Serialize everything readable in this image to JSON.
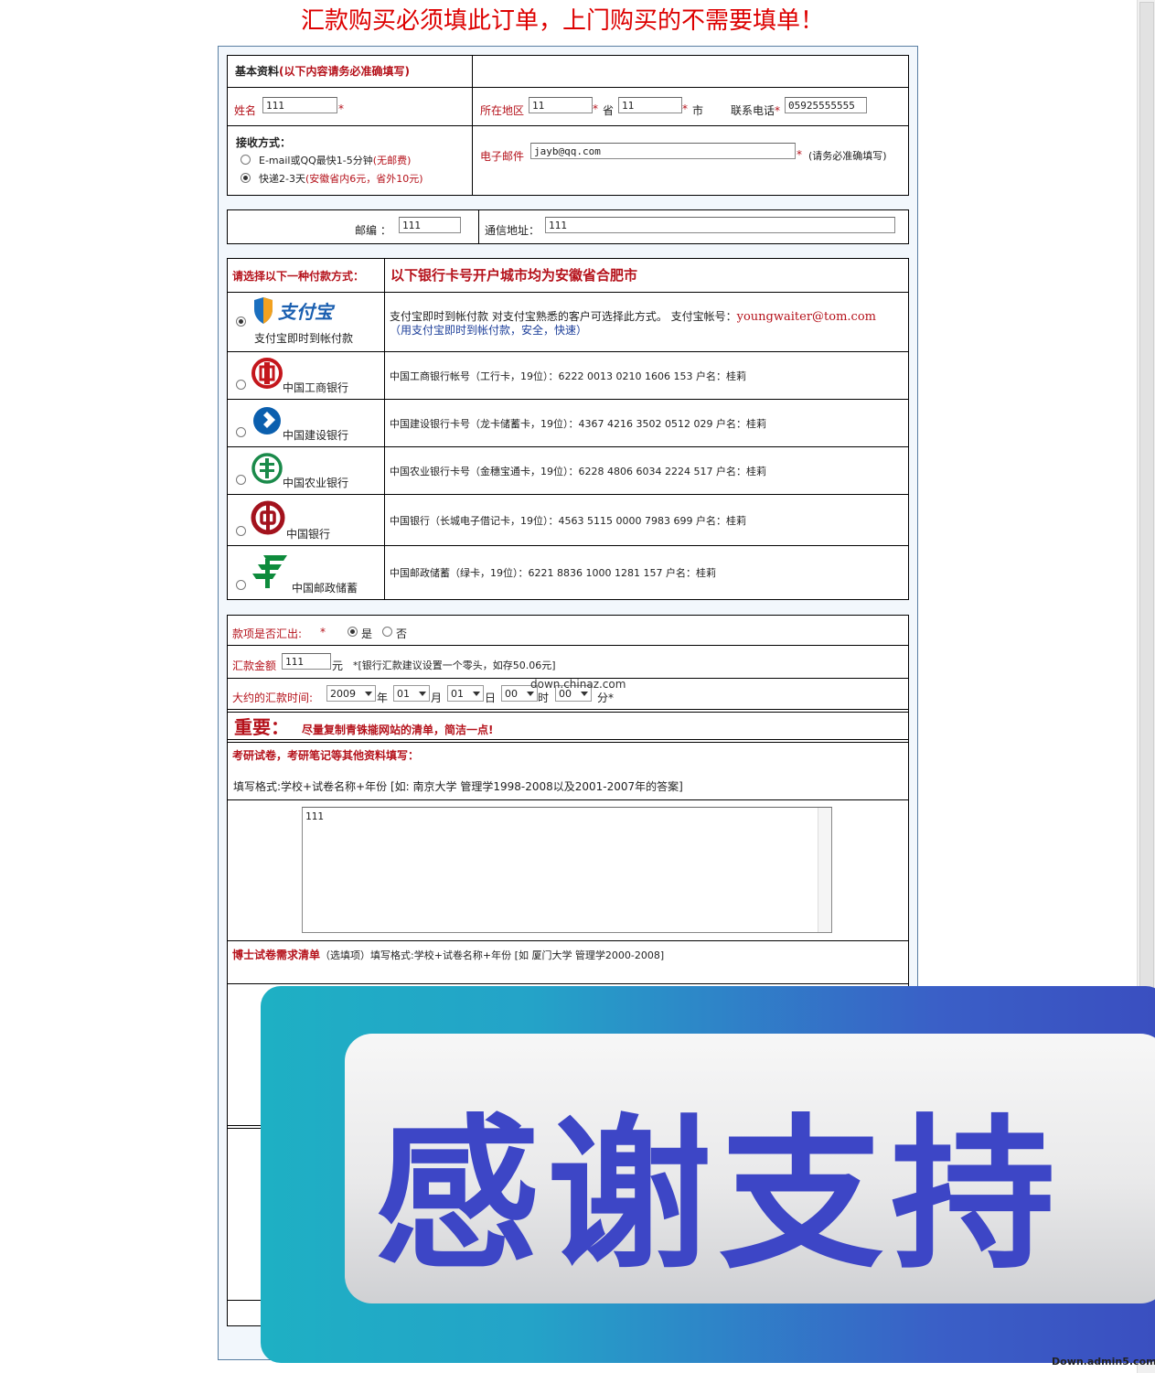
{
  "page_title": "汇款购买必须填此订单，上门购买的不需要填单！",
  "basic": {
    "heading": "基本资料",
    "heading_note": "(以下内容请务必准确填写)",
    "name_label": "姓名",
    "name_value": "111",
    "region_label": "所在地区",
    "province_value": "11",
    "province_unit": "省",
    "city_value": "11",
    "city_unit": "市",
    "phone_label": "联系电话",
    "phone_value": "05925555555",
    "star": "*",
    "receive_label": "接收方式：",
    "option_email_a": "E-mail或QQ最快1-5分钟",
    "option_email_b": "(无邮费)",
    "option_express_a": "快递2-3天",
    "option_express_b": "(安徽省内6元，省外10元)",
    "email_label": "电子邮件",
    "email_value": "jayb@qq.com",
    "email_note": "(请务必准确填写)"
  },
  "address": {
    "zip_label": "邮编 ：",
    "zip_value": "111",
    "addr_label": "通信地址：",
    "addr_value": "111"
  },
  "payment": {
    "choose_label": "请选择以下一种付款方式：",
    "city_note": "以下银行卡号开户城市均为安徽省合肥市",
    "alipay_logo_text": "支付宝",
    "alipay_label": "支付宝即时到帐付款",
    "alipay_desc": "支付宝即时到帐付款   对支付宝熟悉的客户可选择此方式。  支付宝帐号：",
    "alipay_account": "youngwaiter@tom.com",
    "alipay_sub": "（用支付宝即时到帐付款，安全，快速）",
    "banks": [
      {
        "label": "中国工商银行",
        "desc": "中国工商银行帐号（工行卡，19位）：6222 0013 0210 1606 153 户名：桂莉"
      },
      {
        "label": "中国建设银行",
        "desc": "中国建设银行卡号（龙卡储蓄卡，19位）：4367 4216 3502 0512 029 户名：桂莉"
      },
      {
        "label": "中国农业银行",
        "desc": "中国农业银行卡号（金穗宝通卡，19位）：6228 4806 6034 2224 517 户名：桂莉"
      },
      {
        "label": "中国银行",
        "desc": "中国银行（长城电子借记卡，19位）：4563 5115 0000 7983 699 户名：桂莉"
      },
      {
        "label": "中国邮政储蓄",
        "desc": "中国邮政储蓄（绿卡，19位）：6221 8836 1000 1281 157 户名：桂莉"
      }
    ]
  },
  "remit": {
    "sent_label": "款项是否汇出:",
    "yes": "是",
    "no": "否",
    "amount_label": "汇款金额",
    "amount_value": "111",
    "amount_unit": "元",
    "amount_note": "*[银行汇款建议设置一个零头，如存50.06元]",
    "time_label": "大约的汇款时间:",
    "year": "2009",
    "year_unit": "年",
    "month": "01",
    "month_unit": "月",
    "day": "01",
    "day_unit": "日",
    "hour": "00",
    "hour_unit": "时",
    "minute": "00",
    "minute_unit": "分*",
    "overlay_site": "down.chinaz.com"
  },
  "important": {
    "title": "重要：",
    "note": "尽量复制青铢㨢网站的清单，简洁一点!"
  },
  "exam": {
    "heading": "考研试卷，考研笔记等其他资料填写：",
    "format": "填写格式:学校+试卷名称+年份 [如:  南京大学 管理学1998-2008以及2001-2007年的答案]",
    "textarea_value": "111",
    "phd_heading": "博士试卷需求清单",
    "phd_note": "（选填项）填写格式:学校+试卷名称+年份 [如 厦门大学 管理学2000-2008]"
  },
  "banner": {
    "text": "感谢支持"
  },
  "watermark": "Down.admin5.com"
}
